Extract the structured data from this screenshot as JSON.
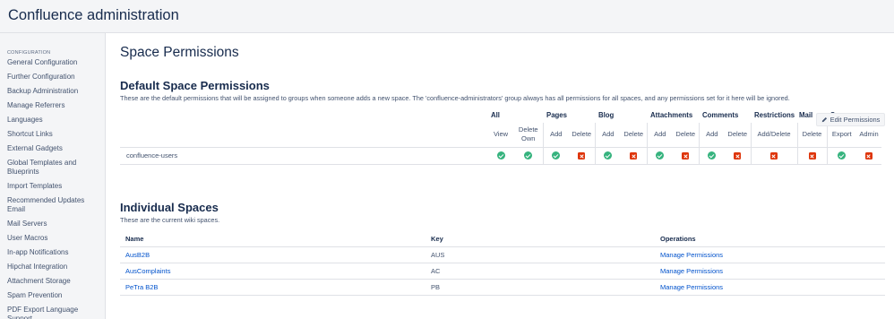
{
  "header": {
    "title": "Confluence administration"
  },
  "sidebar": {
    "section": "CONFIGURATION",
    "items": [
      "General Configuration",
      "Further Configuration",
      "Backup Administration",
      "Manage Referrers",
      "Languages",
      "Shortcut Links",
      "External Gadgets",
      "Global Templates and Blueprints",
      "Import Templates",
      "Recommended Updates Email",
      "Mail Servers",
      "User Macros",
      "In-app Notifications",
      "Hipchat Integration",
      "Attachment Storage",
      "Spam Prevention",
      "PDF Export Language Support"
    ]
  },
  "main": {
    "page_title": "Space Permissions",
    "default_title": "Default Space Permissions",
    "edit_button": "Edit Permissions",
    "default_desc": "These are the default permissions that will be assigned to groups when someone adds a new space. The 'confluence-administrators' group always has all permissions for all spaces, and any permissions set for it here will be ignored.",
    "groups": [
      "All",
      "Pages",
      "Blog",
      "Attachments",
      "Comments",
      "Restrictions",
      "Mail",
      "Space"
    ],
    "subs": [
      "View",
      "Delete Own",
      "Add",
      "Delete",
      "Add",
      "Delete",
      "Add",
      "Delete",
      "Add",
      "Delete",
      "Add/Delete",
      "Delete",
      "Export",
      "Admin"
    ],
    "row_name": "confluence-users",
    "row_values": [
      true,
      true,
      true,
      false,
      true,
      false,
      true,
      false,
      true,
      false,
      false,
      false,
      true,
      false
    ],
    "individual_title": "Individual Spaces",
    "individual_desc": "These are the current wiki spaces.",
    "columns": {
      "name": "Name",
      "key": "Key",
      "operations": "Operations"
    },
    "spaces": [
      {
        "name": "AusB2B",
        "key": "AUS",
        "operation": "Manage Permissions"
      },
      {
        "name": "AusComplaints",
        "key": "AC",
        "operation": "Manage Permissions"
      },
      {
        "name": "PeTra B2B",
        "key": "PB",
        "operation": "Manage Permissions"
      }
    ]
  },
  "colors": {
    "allowed": "#36b37e",
    "denied": "#de350b",
    "link": "#0052cc"
  }
}
